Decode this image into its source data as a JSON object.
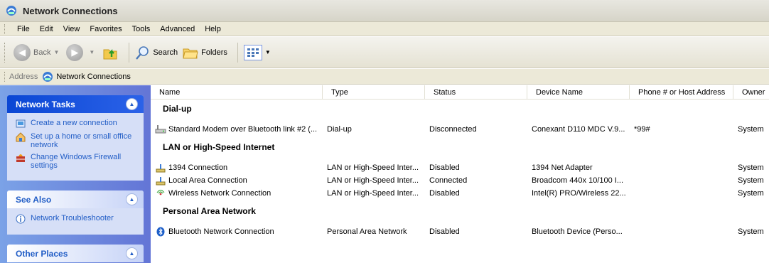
{
  "window": {
    "title": "Network Connections"
  },
  "menu": {
    "items": [
      "File",
      "Edit",
      "View",
      "Favorites",
      "Tools",
      "Advanced",
      "Help"
    ]
  },
  "toolbar": {
    "back_label": "Back",
    "search_label": "Search",
    "folders_label": "Folders"
  },
  "address": {
    "label": "Address",
    "value": "Network Connections"
  },
  "taskpane": {
    "network_tasks": {
      "title": "Network Tasks",
      "items": [
        {
          "label": "Create a new connection",
          "icon": "new-connection-icon"
        },
        {
          "label": "Set up a home or small office network",
          "icon": "home-network-icon"
        },
        {
          "label": "Change Windows Firewall settings",
          "icon": "firewall-icon"
        }
      ]
    },
    "see_also": {
      "title": "See Also",
      "items": [
        {
          "label": "Network Troubleshooter",
          "icon": "info-icon"
        }
      ]
    },
    "other_places": {
      "title": "Other Places"
    }
  },
  "listview": {
    "columns": [
      "Name",
      "Type",
      "Status",
      "Device Name",
      "Phone # or Host Address",
      "Owner"
    ],
    "groups": [
      {
        "title": "Dial-up",
        "rows": [
          {
            "name": "Standard Modem over Bluetooth link #2 (...",
            "type": "Dial-up",
            "status": "Disconnected",
            "device": "Conexant D110 MDC V.9...",
            "phone": "*99#",
            "owner": "System",
            "icon": "modem-icon"
          }
        ]
      },
      {
        "title": "LAN or High-Speed Internet",
        "rows": [
          {
            "name": "1394 Connection",
            "type": "LAN or High-Speed Inter...",
            "status": "Disabled",
            "device": "1394 Net Adapter",
            "phone": "",
            "owner": "System",
            "icon": "lan-icon"
          },
          {
            "name": "Local Area Connection",
            "type": "LAN or High-Speed Inter...",
            "status": "Connected",
            "device": "Broadcom 440x 10/100 I...",
            "phone": "",
            "owner": "System",
            "icon": "lan-icon"
          },
          {
            "name": "Wireless Network Connection",
            "type": "LAN or High-Speed Inter...",
            "status": "Disabled",
            "device": "Intel(R) PRO/Wireless 22...",
            "phone": "",
            "owner": "System",
            "icon": "wireless-icon"
          }
        ]
      },
      {
        "title": "Personal Area Network",
        "rows": [
          {
            "name": "Bluetooth Network Connection",
            "type": "Personal Area Network",
            "status": "Disabled",
            "device": "Bluetooth Device (Perso...",
            "phone": "",
            "owner": "System",
            "icon": "bluetooth-icon"
          }
        ]
      }
    ]
  }
}
